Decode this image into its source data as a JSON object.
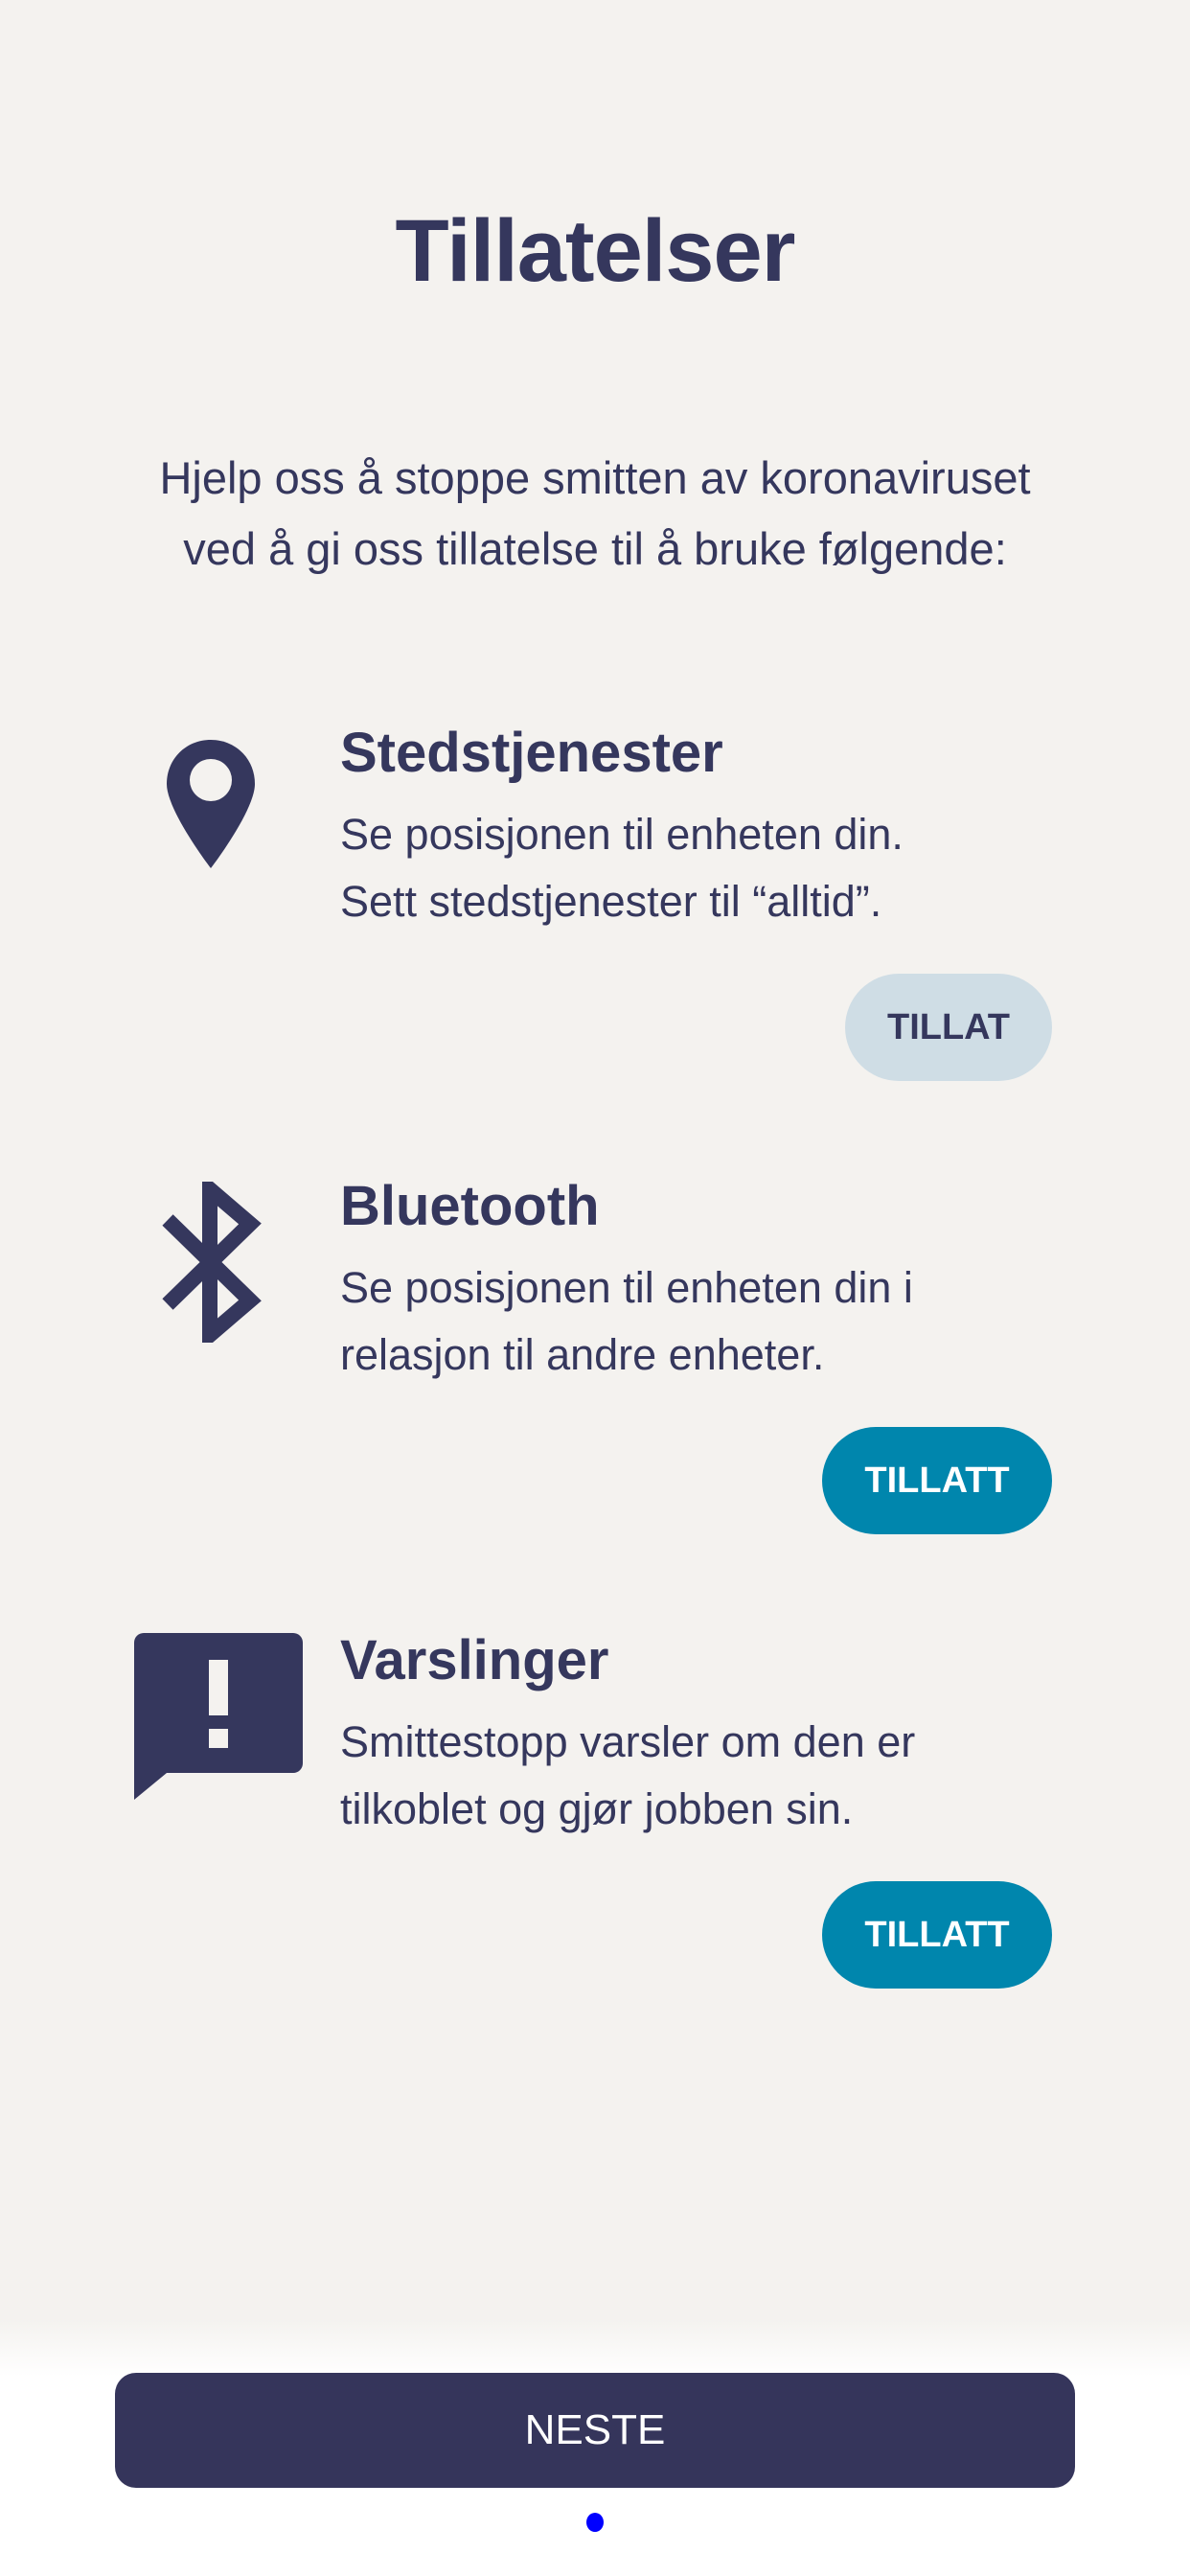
{
  "title": "Tillatelser",
  "intro": "Hjelp oss å stoppe smitten av koronaviruset ved å gi oss tillatelse til å bruke følgende:",
  "permissions": [
    {
      "icon": "location-pin-icon",
      "heading": "Stedstjenester",
      "body_lines": [
        "Se posisjonen til enheten din.",
        "Sett stedstjenester til “alltid”."
      ],
      "button": "TILLAT",
      "granted": false
    },
    {
      "icon": "bluetooth-icon",
      "heading": "Bluetooth",
      "body_lines": [
        "Se posisjonen til enheten din i",
        "relasjon til andre enheter."
      ],
      "button": "TILLATT",
      "granted": true
    },
    {
      "icon": "notification-alert-icon",
      "heading": "Varslinger",
      "body_lines": [
        "Smittestopp varsler om den er",
        "tilkoblet og gjør jobben sin."
      ],
      "button": "TILLATT",
      "granted": true
    }
  ],
  "next_label": "NESTE",
  "colors": {
    "background": "#f4f2ef",
    "navy": "#35375d",
    "teal": "#0086ad",
    "pending": "#cfdde5",
    "page_dot": "#0000ff"
  }
}
